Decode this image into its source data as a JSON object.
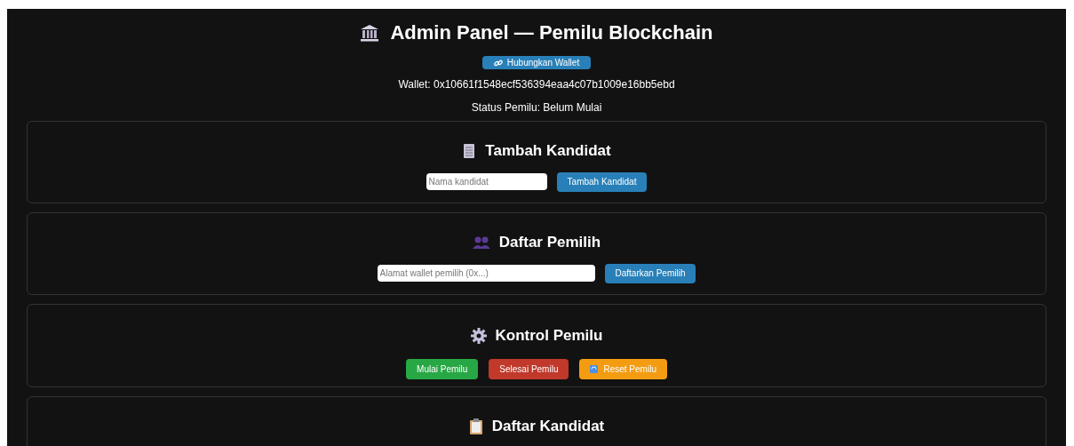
{
  "title": "Admin Panel — Pemilu Blockchain",
  "connect_button": {
    "label": "Hubungkan Wallet"
  },
  "wallet": "Wallet: 0x10661f1548ecf536394eaa4c07b1009e16bb5ebd",
  "status": "Status Pemilu: Belum Mulai",
  "sections": [
    {
      "kind": "form",
      "title": "Tambah Kandidat",
      "placeholder": "Nama kandidat",
      "button": "Tambah Kandidat"
    },
    {
      "kind": "form",
      "title": "Daftar Pemilih",
      "placeholder": "Alamat wallet pemilih (0x...)",
      "button": "Daftarkan Pemilih"
    },
    {
      "kind": "controls",
      "title": "Kontrol Pemilu",
      "buttons": [
        {
          "label": "Mulai Pemilu",
          "color": "#28a745"
        },
        {
          "label": "Selesai Pemilu",
          "color": "#c0392b"
        },
        {
          "label": "Reset Pemilu",
          "color": "#f39c12"
        }
      ]
    },
    {
      "kind": "heading",
      "title": "Daftar Kandidat"
    }
  ]
}
